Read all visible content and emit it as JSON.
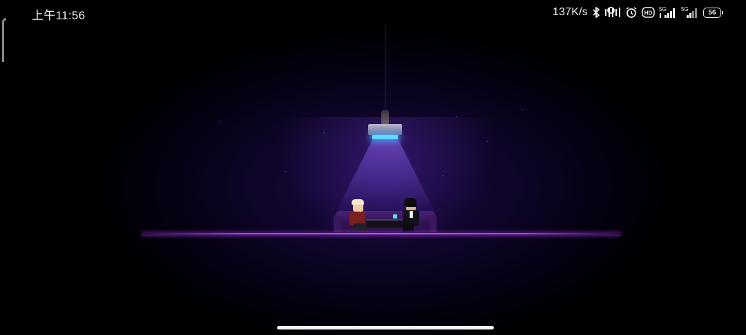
{
  "status_bar": {
    "time": "上午11:56",
    "net_speed": "137K/s",
    "signal_5g_label": "5G",
    "hd_label": "HD",
    "battery_level": "56",
    "icons": [
      "bluetooth-icon",
      "vibrate-icon",
      "alarm-icon",
      "hd-icon",
      "signal-5g-icon",
      "signal-5g-icon",
      "battery-icon"
    ]
  },
  "colors": {
    "floor_neon": "#b13af0",
    "lamp_light": "#63dcff",
    "background": "#000000",
    "ambient_purple": "#1d0a46"
  }
}
